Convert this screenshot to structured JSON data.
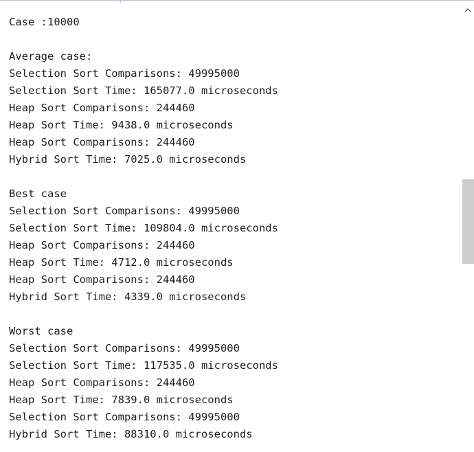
{
  "console": {
    "lines": [
      "Case :10000",
      "",
      "Average case:",
      "Selection Sort Comparisons: 49995000",
      "Selection Sort Time: 165077.0 microseconds",
      "Heap Sort Comparisons: 244460",
      "Heap Sort Time: 9438.0 microseconds",
      "Heap Sort Comparisons: 244460",
      "Hybrid Sort Time: 7025.0 microseconds",
      "",
      "Best case",
      "Selection Sort Comparisons: 49995000",
      "Selection Sort Time: 109804.0 microseconds",
      "Heap Sort Comparisons: 244460",
      "Heap Sort Time: 4712.0 microseconds",
      "Heap Sort Comparisons: 244460",
      "Hybrid Sort Time: 4339.0 microseconds",
      "",
      "Worst case",
      "Selection Sort Comparisons: 49995000",
      "Selection Sort Time: 117535.0 microseconds",
      "Heap Sort Comparisons: 244460",
      "Heap Sort Time: 7839.0 microseconds",
      "Selection Sort Comparisons: 49995000",
      "Hybrid Sort Time: 88310.0 microseconds"
    ]
  },
  "scrollbar": {
    "up_icon": "chevron-up-icon",
    "thumb_color": "#cdcdcd"
  },
  "colors": {
    "text": "#1e1e1e",
    "background": "#ffffff",
    "border": "#b9c3cf"
  }
}
